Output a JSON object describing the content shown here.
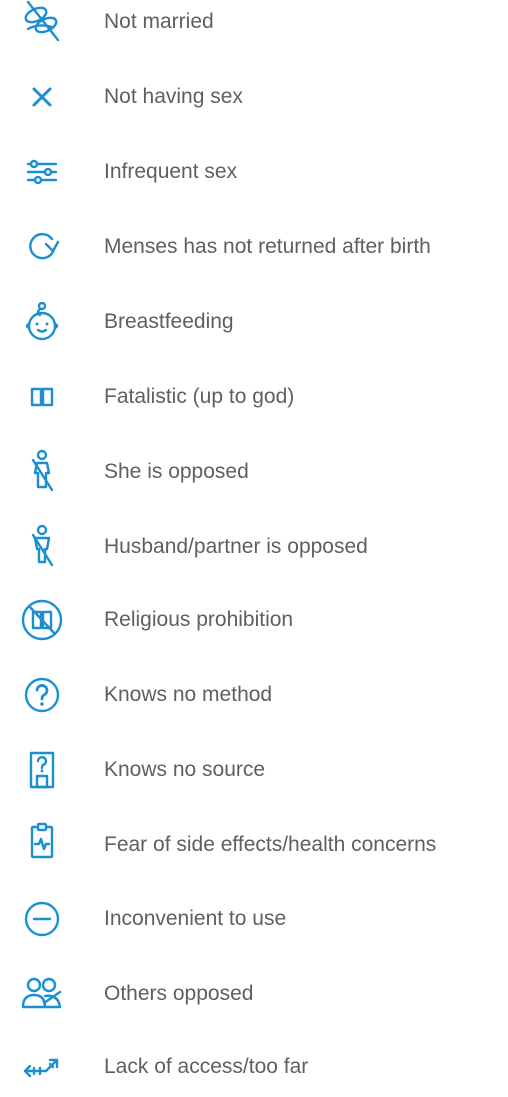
{
  "colors": {
    "icon": "#1b8fd0",
    "text": "#5f5f5f",
    "background": "#ffffff"
  },
  "items": [
    {
      "icon": "rings-crossed-icon",
      "label": "Not married"
    },
    {
      "icon": "x-icon",
      "label": "Not having sex"
    },
    {
      "icon": "sliders-icon",
      "label": "Infrequent sex"
    },
    {
      "icon": "refresh-icon",
      "label": "Menses has not returned after birth"
    },
    {
      "icon": "baby-face-icon",
      "label": "Breastfeeding"
    },
    {
      "icon": "open-book-icon",
      "label": "Fatalistic (up to god)"
    },
    {
      "icon": "woman-crossed-icon",
      "label": "She is opposed"
    },
    {
      "icon": "man-crossed-icon",
      "label": "Husband/partner is opposed"
    },
    {
      "icon": "book-prohibited-icon",
      "label": "Religious prohibition"
    },
    {
      "icon": "question-circle-icon",
      "label": "Knows no method"
    },
    {
      "icon": "question-door-icon",
      "label": "Knows no source"
    },
    {
      "icon": "clipboard-pulse-icon",
      "label": "Fear of side effects/health concerns"
    },
    {
      "icon": "minus-circle-icon",
      "label": "Inconvenient to use"
    },
    {
      "icon": "people-crossed-icon",
      "label": "Others opposed"
    },
    {
      "icon": "long-arrows-icon",
      "label": "Lack of access/too far"
    }
  ]
}
